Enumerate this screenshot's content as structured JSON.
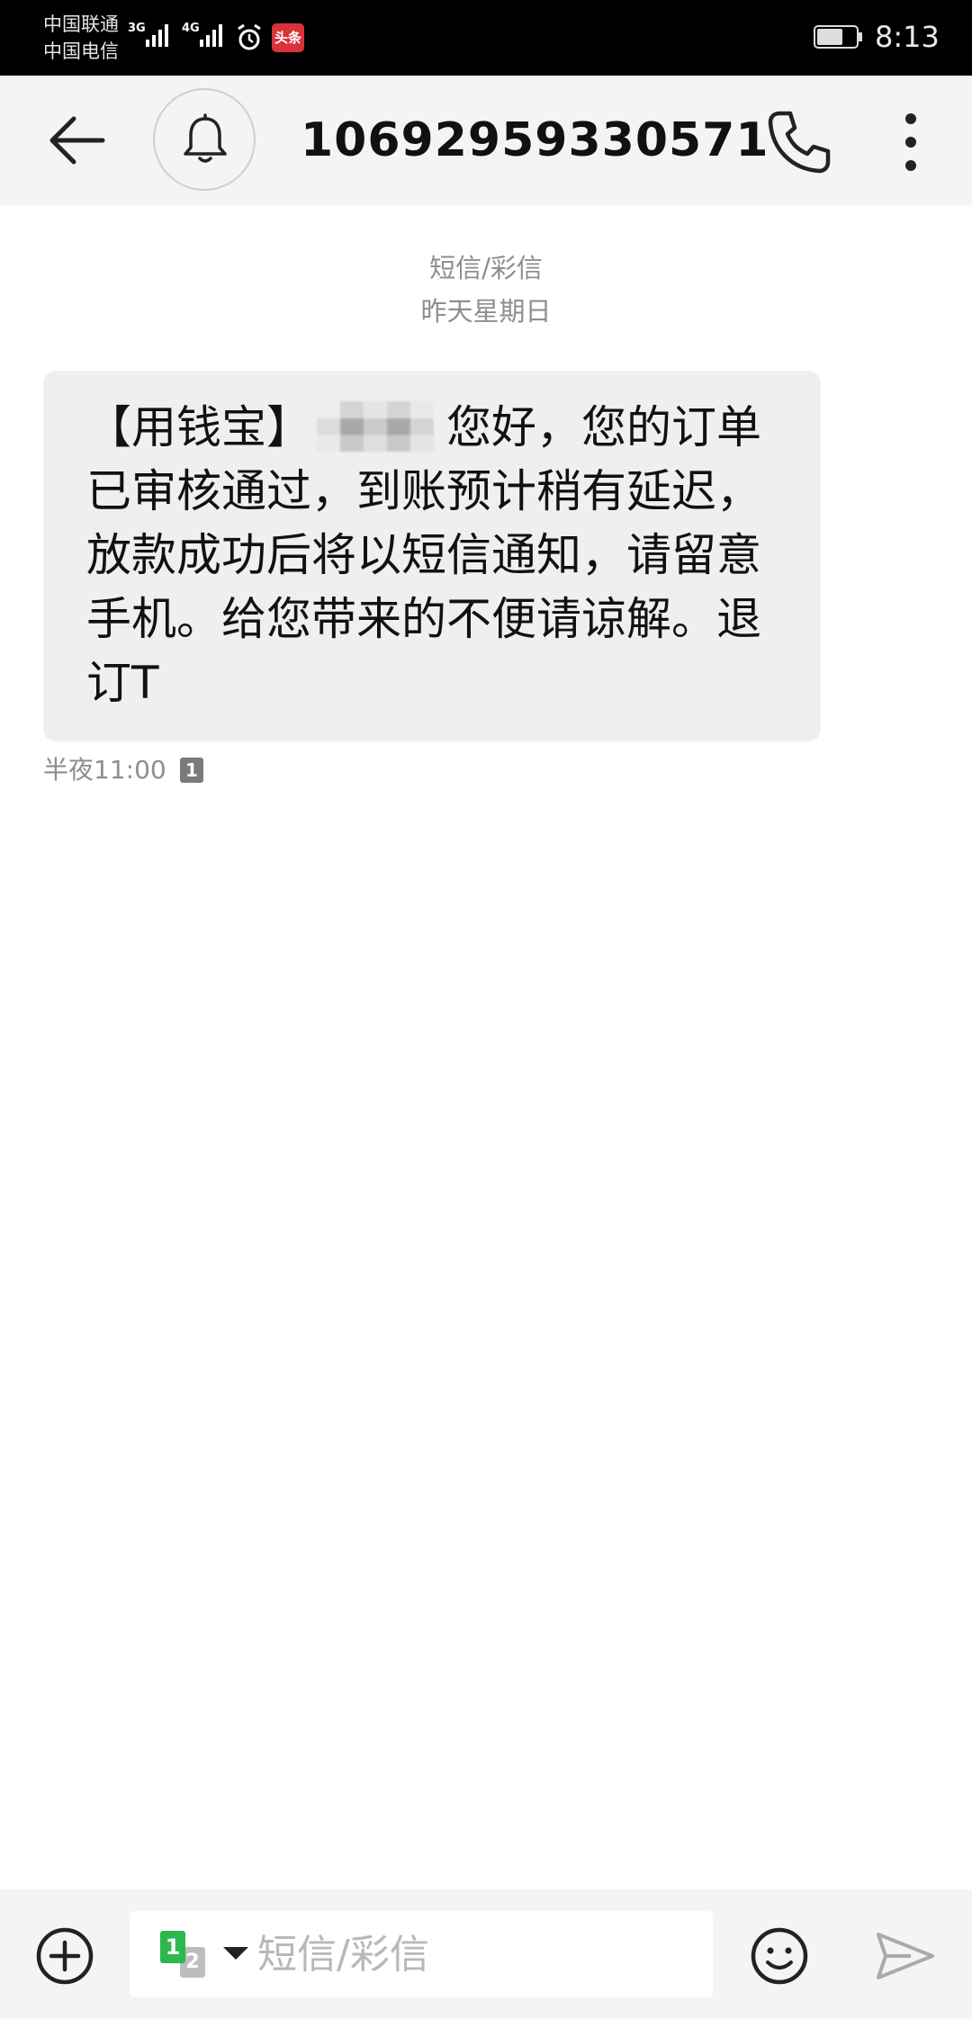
{
  "status_bar": {
    "carrier1": "中国联通",
    "carrier2": "中国电信",
    "net1": "3G",
    "net2": "4G",
    "news_badge": "头条",
    "time": "8:13"
  },
  "header": {
    "title": "10692959330571",
    "icons": [
      "back-arrow-icon",
      "bell-icon",
      "phone-icon",
      "more-vert-icon"
    ]
  },
  "conversation": {
    "type_label": "短信/彩信",
    "date_label": "昨天星期日",
    "messages": [
      {
        "text_before": "【用钱宝】",
        "text_after": "您好，您的订单已审核通过，到账预计稍有延迟，放款成功后将以短信通知，请留意手机。给您带来的不便请谅解。退订T",
        "time": "半夜11:00",
        "sim": "1"
      }
    ]
  },
  "compose": {
    "placeholder": "短信/彩信",
    "sim_primary": "1",
    "sim_secondary": "2"
  },
  "colors": {
    "status_bg": "#000000",
    "header_bg": "#f4f4f4",
    "bubble_bg": "#efefef",
    "meta_text": "#8e8e8e",
    "sim1_green": "#2db84d",
    "news_red": "#d8323a"
  }
}
